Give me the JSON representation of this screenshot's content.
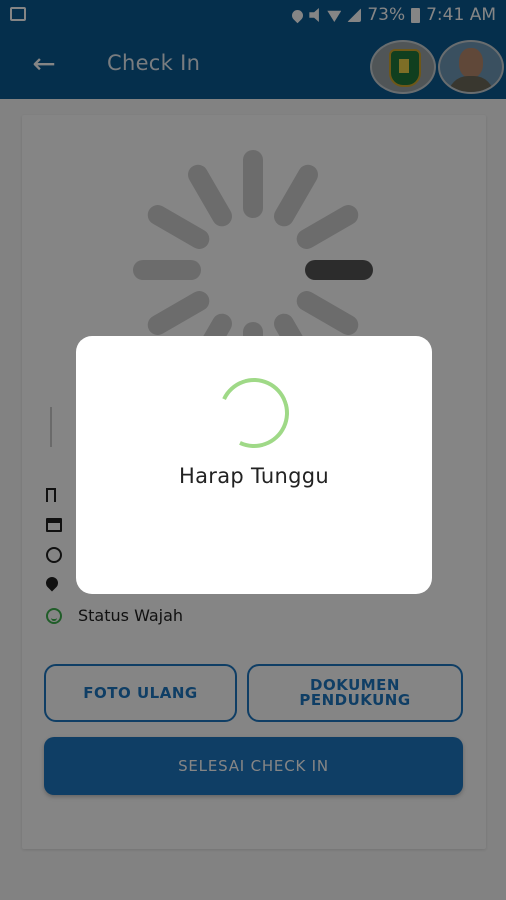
{
  "status_bar": {
    "battery_percent": "73%",
    "time": "7:41 AM"
  },
  "app_bar": {
    "title": "Check In"
  },
  "info": {
    "status_wajah": "Status Wajah"
  },
  "buttons": {
    "foto_ulang": "FOTO ULANG",
    "dokumen_line1": "DOKUMEN",
    "dokumen_line2": "PENDUKUNG",
    "selesai": "SELESAI CHECK IN"
  },
  "dialog": {
    "message": "Harap Tunggu"
  },
  "colors": {
    "app_bar": "#0a5a93",
    "primary": "#1e78c2",
    "spinner": "#9fd987",
    "face_status_icon": "#3fb34f"
  }
}
